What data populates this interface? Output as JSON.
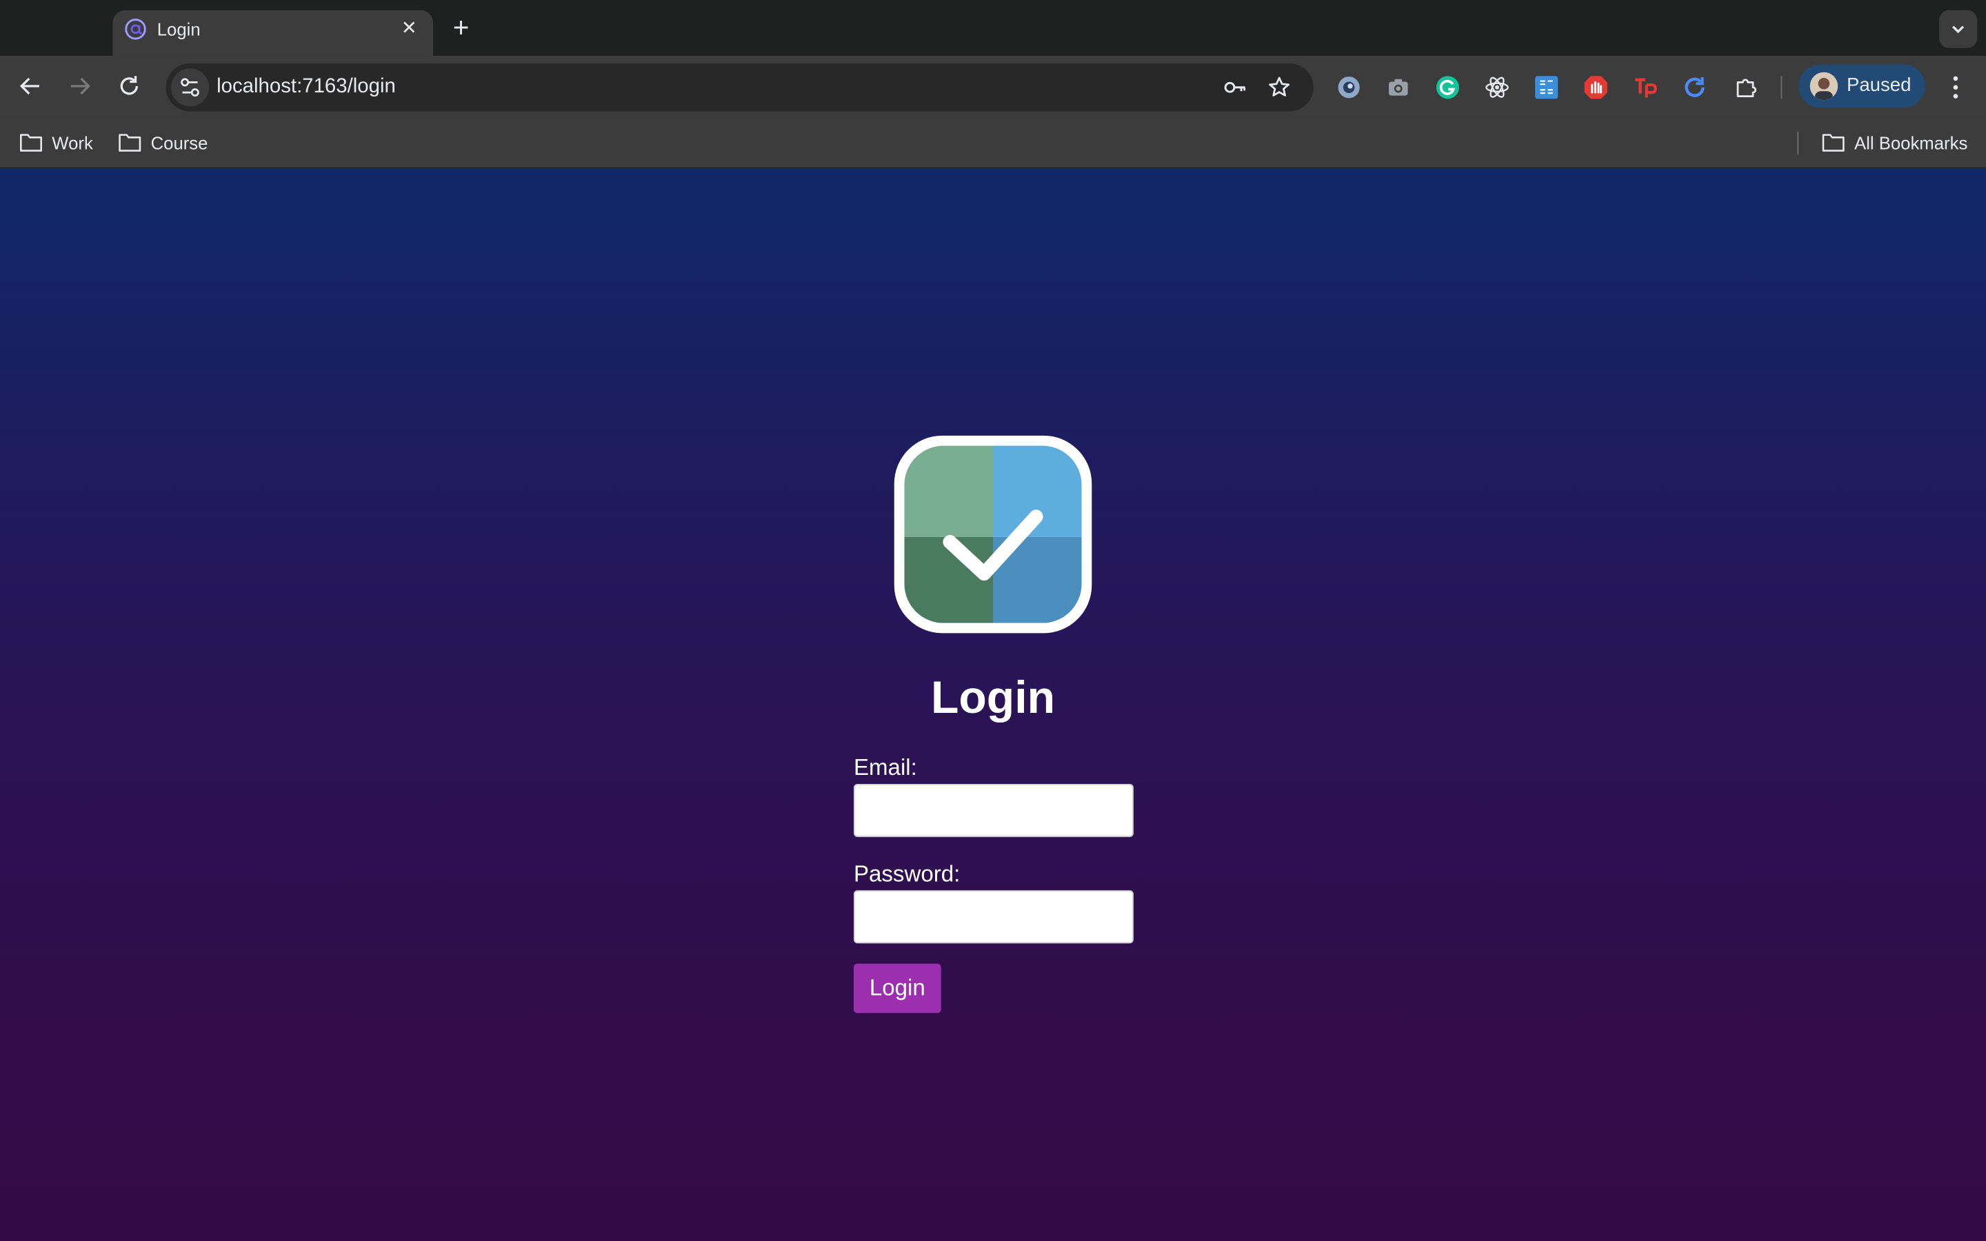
{
  "browser": {
    "tab": {
      "title": "Login",
      "favicon": "at-sign-icon"
    },
    "address": {
      "url": "localhost:7163/login"
    },
    "profile": {
      "label": "Paused"
    },
    "bookmarks": [
      {
        "label": "Work",
        "icon": "folder-icon"
      },
      {
        "label": "Course",
        "icon": "folder-icon"
      }
    ],
    "all_bookmarks": "All Bookmarks",
    "extensions": [
      "extension-icon-1",
      "camera-icon",
      "grammarly-icon",
      "react-devtools-icon",
      "saml-icon",
      "adblock-icon",
      "tp-icon",
      "refresh-ext-icon",
      "puzzle-icon"
    ]
  },
  "page": {
    "title": "Login",
    "email_label": "Email:",
    "email_value": "",
    "password_label": "Password:",
    "password_value": "",
    "submit_label": "Login",
    "accent_color": "#9b2fae"
  }
}
